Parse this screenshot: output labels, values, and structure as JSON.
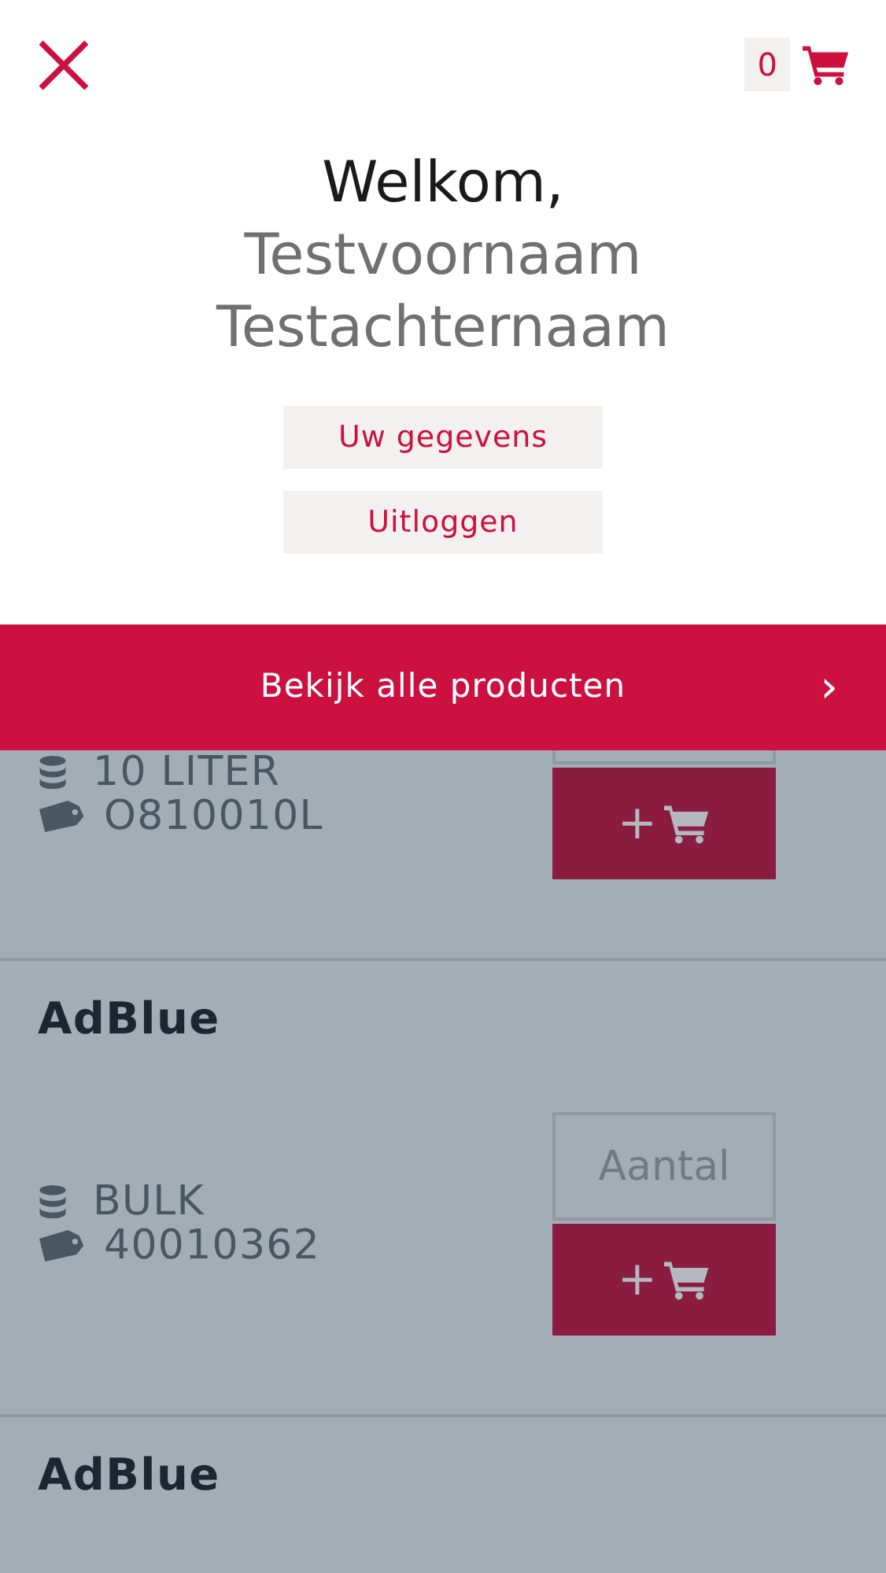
{
  "header": {
    "cart_count": "0"
  },
  "welcome": {
    "greeting": "Welkom,",
    "first_name": "Testvoornaam",
    "last_name": "Testachternaam"
  },
  "account_buttons": [
    "Uw gegevens",
    "Uitloggen"
  ],
  "banner": {
    "label": "Bekijk alle producten",
    "chevron": "›"
  },
  "products": [
    {
      "unit": "10 LITER",
      "code": "O810010L",
      "add_symbol": "+"
    },
    {
      "name": "AdBlue",
      "unit": "BULK",
      "code": "40010362",
      "quantity_placeholder": "Aantal",
      "add_symbol": "+"
    },
    {
      "name": "AdBlue"
    }
  ]
}
